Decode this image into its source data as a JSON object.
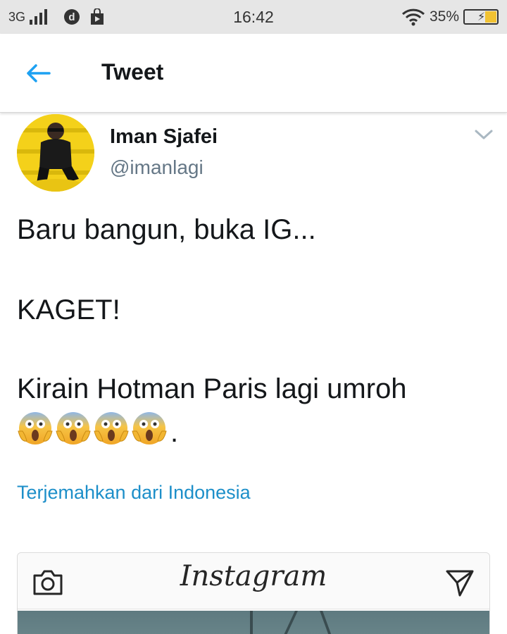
{
  "status_bar": {
    "network": "3G",
    "time": "16:42",
    "battery_percent": "35%",
    "battery_level": 0.35,
    "colors": {
      "battery_fill": "#f1c232"
    }
  },
  "header": {
    "title": "Tweet",
    "back_icon": "arrow-left-icon",
    "accent": "#1da1f2"
  },
  "tweet": {
    "author_name": "Iman Sjafei",
    "author_handle": "@imanlagi",
    "lines": [
      "Baru bangun, buka IG...",
      "KAGET!",
      "Kirain Hotman Paris lagi umroh"
    ],
    "emoji": "face-screaming-in-fear",
    "emoji_count": 4,
    "trailing_punctuation": ".",
    "translate_link": "Terjemahkan dari Indonesia"
  },
  "embed": {
    "logo": "Instagram",
    "left_icon": "camera-icon",
    "right_icon": "send-icon"
  }
}
